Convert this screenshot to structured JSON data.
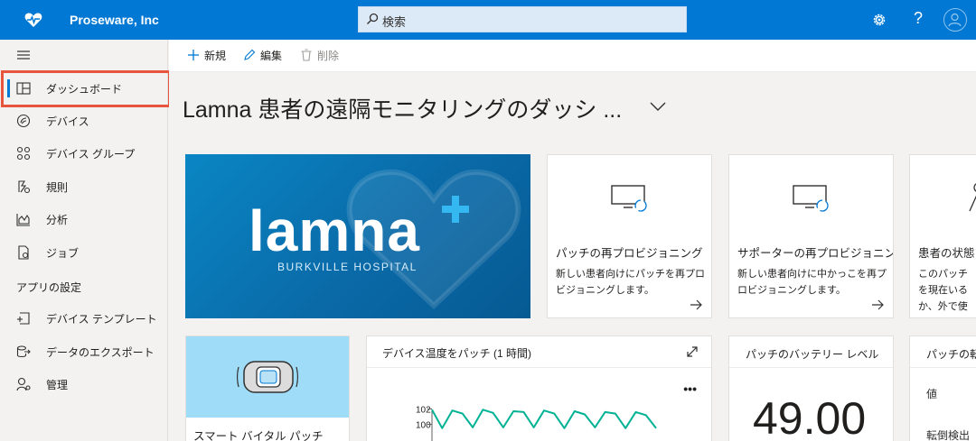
{
  "app": {
    "brand": "Proseware, Inc",
    "logo_icon": "heart-pulse-icon"
  },
  "search": {
    "placeholder": "検索"
  },
  "topbar": {
    "settings_icon": "gear-icon",
    "help_label": "?",
    "user_icon": "avatar-icon"
  },
  "sidebar": {
    "items": [
      {
        "label": "ダッシュボード",
        "icon": "dashboard-icon",
        "active": true
      },
      {
        "label": "デバイス",
        "icon": "device-icon"
      },
      {
        "label": "デバイス グループ",
        "icon": "device-group-icon"
      },
      {
        "label": "規則",
        "icon": "rules-icon"
      },
      {
        "label": "分析",
        "icon": "analytics-icon"
      },
      {
        "label": "ジョブ",
        "icon": "jobs-icon"
      }
    ],
    "section_label": "アプリの設定",
    "settings_items": [
      {
        "label": "デバイス テンプレート",
        "icon": "device-template-icon"
      },
      {
        "label": "データのエクスポート",
        "icon": "data-export-icon"
      },
      {
        "label": "管理",
        "icon": "admin-icon"
      }
    ]
  },
  "commands": {
    "new": "新規",
    "edit": "編集",
    "delete": "削除"
  },
  "page": {
    "title": "Lamna 患者の遠隔モニタリングのダッシ ..."
  },
  "hero": {
    "word": "lamna",
    "subtitle": "BURKVILLE HOSPITAL"
  },
  "tiles": {
    "patch_reprovision": {
      "title": "パッチの再プロビジョニング",
      "desc": "新しい患者向けにパッチを再プロビジョニングします。"
    },
    "supporter_reprovision": {
      "title": "サポーターの再プロビジョニング",
      "desc": "新しい患者向けに中かっこを再プロビジョニングします。"
    },
    "patient_state": {
      "title": "患者の状態",
      "desc": "このパッチを現在いるか、外で使ます。"
    },
    "smart_patch": {
      "label": "スマート バイタル パッチ"
    },
    "temperature": {
      "title": "デバイス温度をパッチ (1 時間)",
      "more": "•••"
    },
    "battery": {
      "title": "パッチのバッテリー レベル",
      "value": "49.00"
    },
    "fall": {
      "title": "パッチの転倒",
      "row1": "値",
      "row2": "転倒検出"
    }
  },
  "chart_data": {
    "type": "line",
    "title": "デバイス温度をパッチ (1 時間)",
    "ylim": [
      99,
      103
    ],
    "y_ticks": [
      "102",
      "100"
    ],
    "series": [
      {
        "values": [
          101.9,
          99.5,
          101.8,
          101.4,
          99.6,
          101.9,
          101.5,
          99.6,
          101.7,
          101.6,
          99.6,
          101.8,
          101.4,
          99.5,
          101.7,
          101.3,
          99.6,
          101.6,
          101.4,
          99.5,
          101.6,
          101.2,
          99.5
        ]
      }
    ],
    "color": "#00b294"
  },
  "colors": {
    "accent": "#0078d4",
    "highlight": "#e8553d",
    "chart": "#00b294",
    "hero": "#0a86c4",
    "patch_bg": "#9fdcf7"
  }
}
